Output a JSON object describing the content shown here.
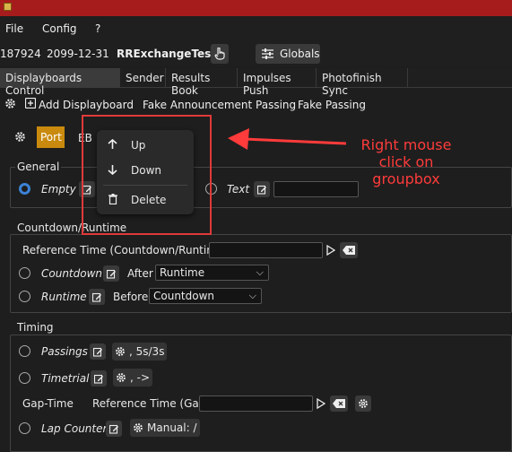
{
  "menubar": {
    "items": [
      "File",
      "Config",
      "?"
    ]
  },
  "infobar": {
    "id": "187924",
    "date": "2099-12-31",
    "event": "RRExchangeTest",
    "globals_label": "Globals"
  },
  "tabs": [
    "Displayboards Control",
    "Sender",
    "Results Book",
    "Impulses Push",
    "Photofinish Sync"
  ],
  "toolbar": {
    "add_displayboard": "Add Displayboard",
    "fake_announcement": "Fake Announcement Passing",
    "fake_passing": "Fake Passing"
  },
  "subtabs": {
    "port": "Port",
    "eb": "EB"
  },
  "general": {
    "title": "General",
    "empty_label": "Empty",
    "text_label": "Text",
    "text_value": ""
  },
  "countdown_runtime": {
    "title": "Countdown/Runtime",
    "reference_label": "Reference Time (Countdown/Runtime)",
    "reference_value": "",
    "countdown_label": "Countdown",
    "after_label": "After",
    "after_value": "Runtime",
    "runtime_label": "Runtime",
    "before_label": "Before",
    "before_value": "Countdown"
  },
  "timing": {
    "title": "Timing",
    "passings_label": "Passings",
    "passings_setting": ", 5s/3s",
    "timetrial_label": "Timetrial",
    "timetrial_setting": ", ->",
    "gap_time_label": "Gap-Time",
    "gap_reference_label": "Reference Time (Gap)",
    "gap_reference_value": "",
    "lap_counter_label": "Lap Counter",
    "lap_counter_setting": "Manual: /"
  },
  "context_menu": {
    "items": [
      "Up",
      "Down",
      "Delete"
    ]
  },
  "annotation": {
    "text": "Right mouse click on groupbox",
    "color": "#ff3b3b"
  },
  "colors": {
    "titlebar": "#a61c1c",
    "accent": "#c98a0e",
    "radio_selected": "#3b82d6",
    "annotation": "#e03a3a"
  }
}
